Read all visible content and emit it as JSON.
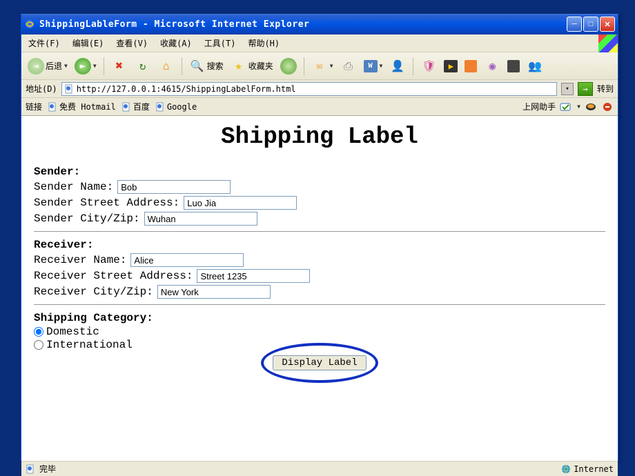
{
  "window": {
    "title": "ShippingLableForm - Microsoft Internet Explorer"
  },
  "menu": {
    "file": "文件(F)",
    "edit": "编辑(E)",
    "view": "查看(V)",
    "favorites": "收藏(A)",
    "tools": "工具(T)",
    "help": "帮助(H)"
  },
  "toolbar": {
    "back": "后退",
    "search": "搜索",
    "favorites": "收藏夹"
  },
  "addressbar": {
    "label": "地址(D)",
    "url": "http://127.0.0.1:4615/ShippingLabelForm.html",
    "go": "转到"
  },
  "linksbar": {
    "label": "链接",
    "link1": "免费 Hotmail",
    "link2": "百度",
    "link3": "Google",
    "helper": "上网助手"
  },
  "page": {
    "heading": "Shipping Label",
    "sender": {
      "head": "Sender:",
      "name_label": "Sender Name:",
      "name_value": "Bob",
      "street_label": "Sender Street Address:",
      "street_value": "Luo Jia",
      "city_label": "Sender City/Zip:",
      "city_value": "Wuhan"
    },
    "receiver": {
      "head": "Receiver:",
      "name_label": "Receiver Name:",
      "name_value": "Alice",
      "street_label": "Receiver Street Address:",
      "street_value": "Street 1235",
      "city_label": "Receiver City/Zip:",
      "city_value": "New York"
    },
    "category": {
      "head": "Shipping Category:",
      "opt1": "Domestic",
      "opt2": "International"
    },
    "submit": "Display Label"
  },
  "status": {
    "text": "完毕",
    "zone": "Internet"
  }
}
